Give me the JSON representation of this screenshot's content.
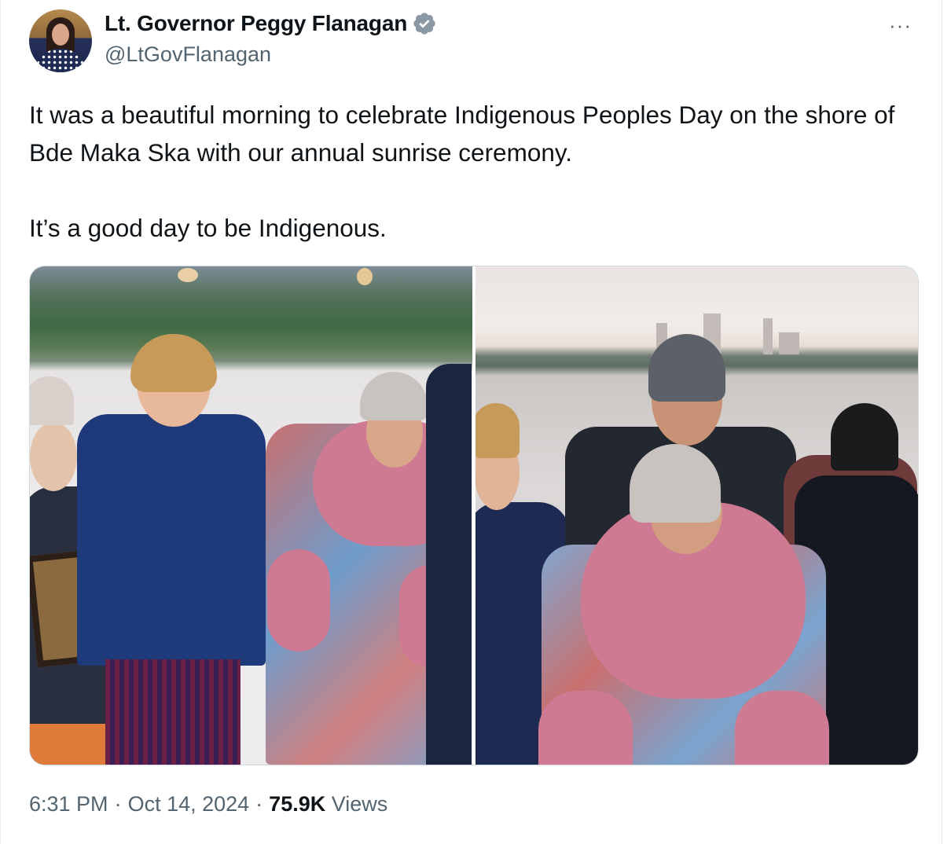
{
  "tweet": {
    "author_name": "Lt. Governor Peggy Flanagan",
    "handle": "@LtGovFlanagan",
    "verified_icon": "verified-badge-icon",
    "more_icon": "more-options-icon",
    "more_label": "···",
    "text_paragraph_1": "It was a beautiful morning to celebrate Indigenous Peoples Day on the shore of Bde Maka Ska with our annual sunrise ceremony.",
    "text_paragraph_2": "It’s a good day to be Indigenous.",
    "time": "6:31 PM",
    "separator": "·",
    "date": "Oct 14, 2024",
    "views_count": "75.9K",
    "views_label": "Views"
  },
  "colors": {
    "text_primary": "#0f1419",
    "text_secondary": "#536471",
    "verified_blue": "#1d9bf0",
    "border": "#cfd9de"
  }
}
